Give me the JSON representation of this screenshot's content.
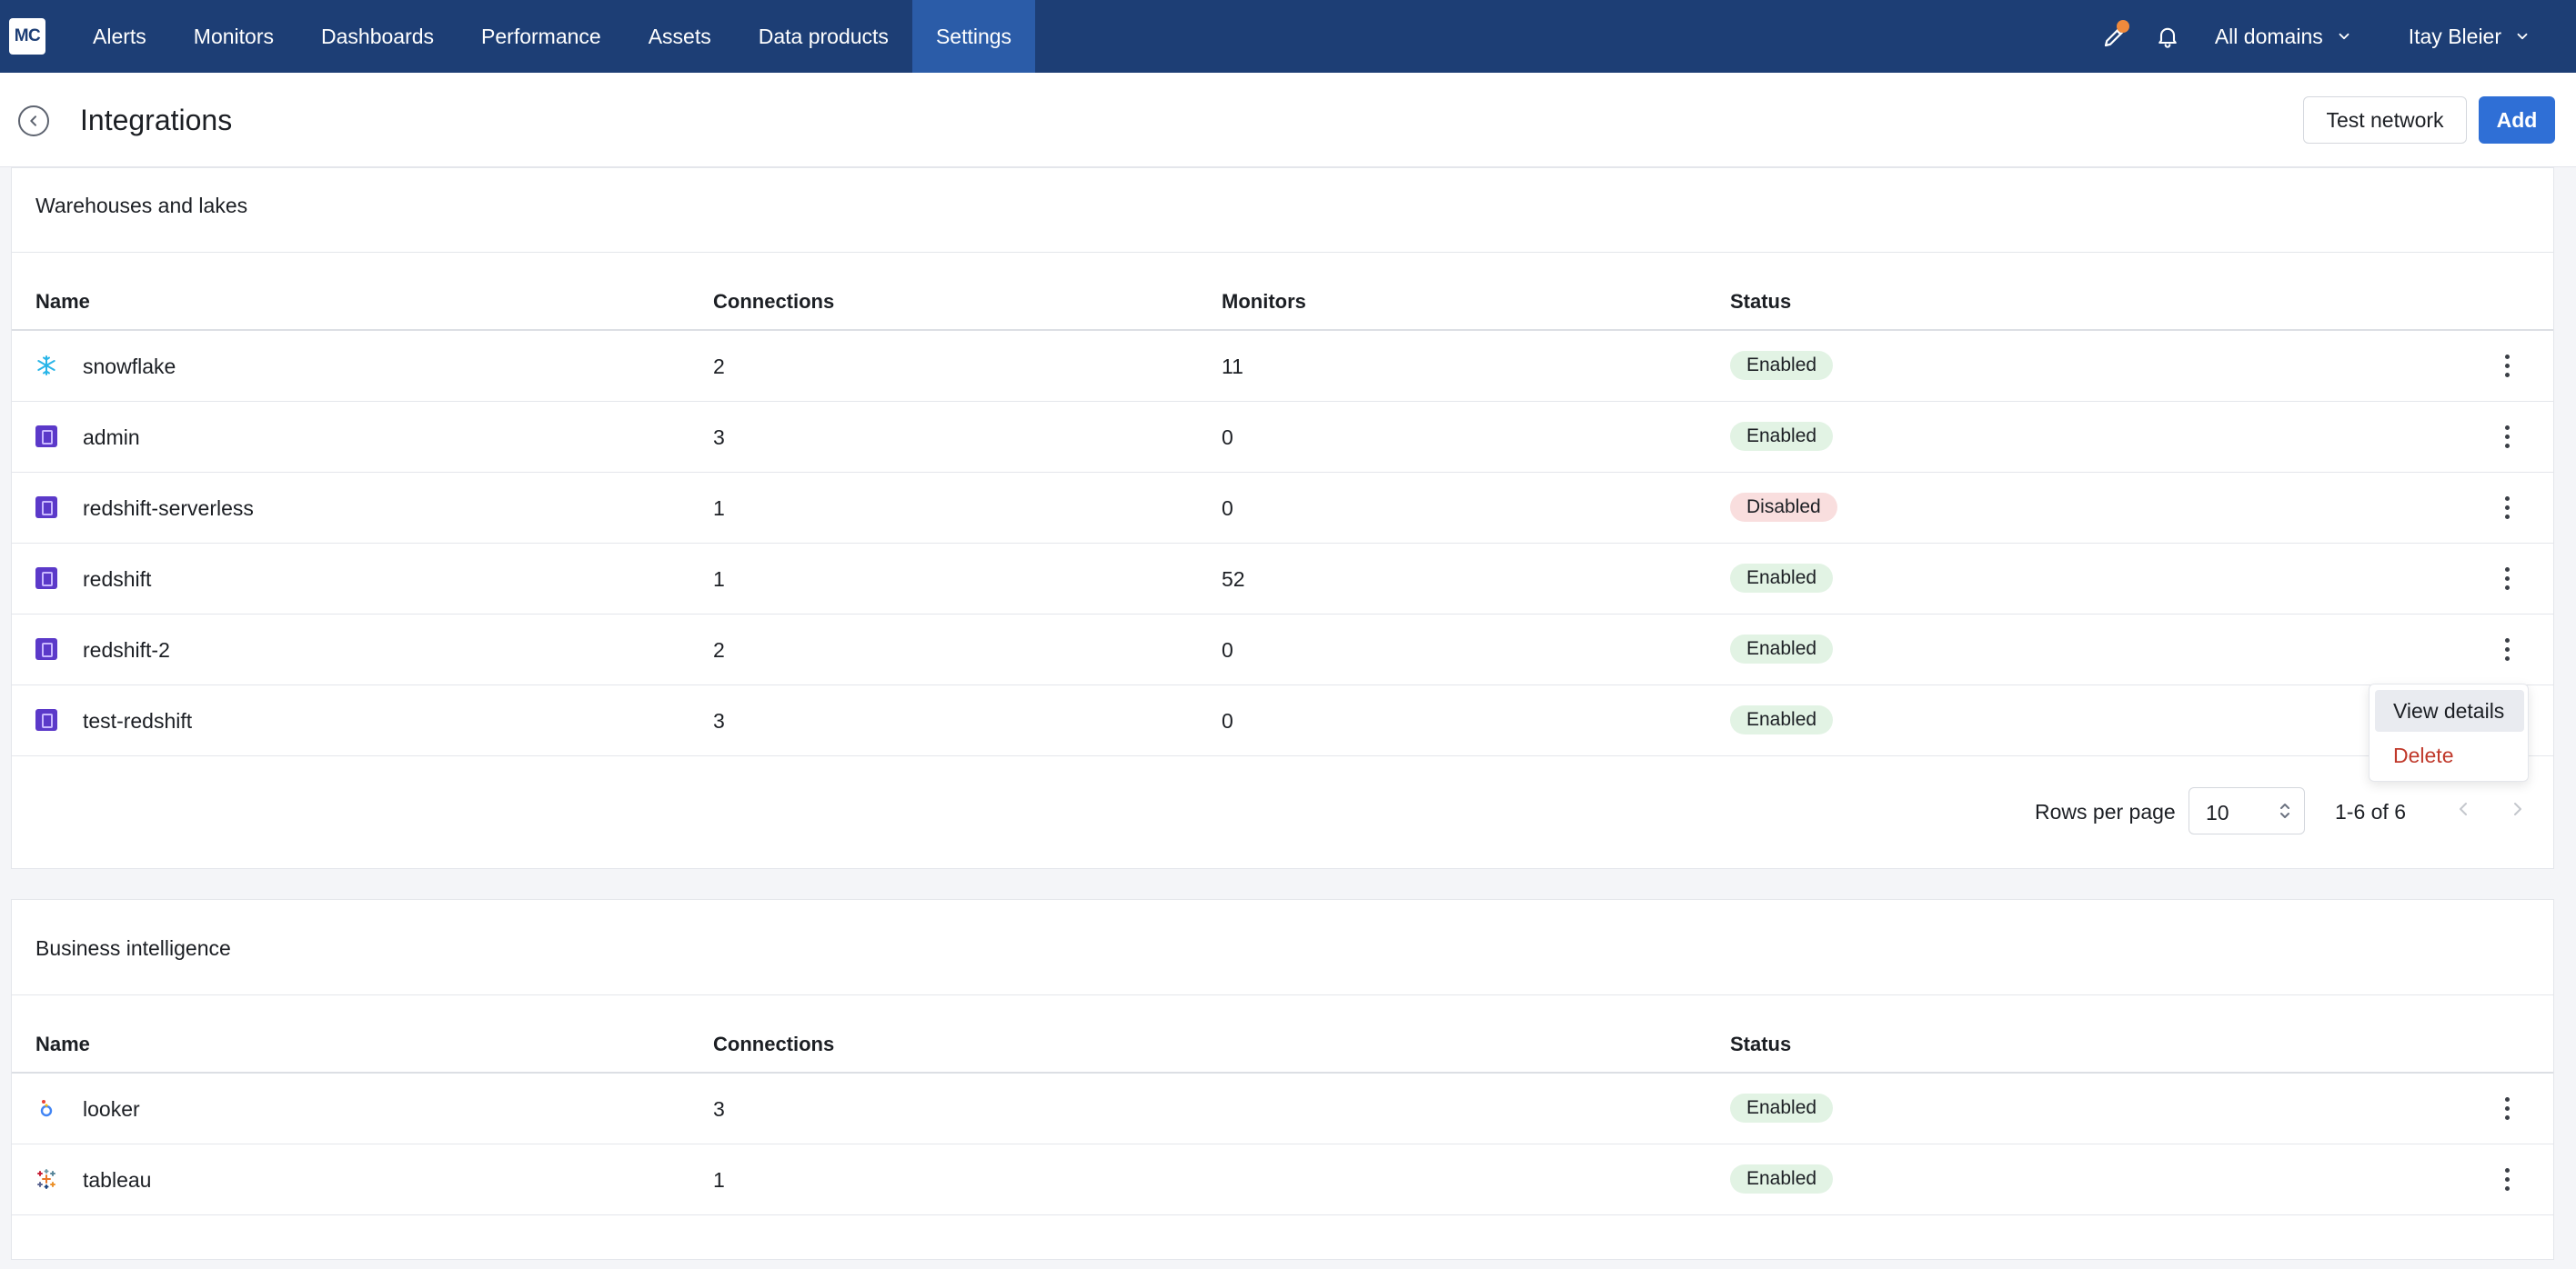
{
  "nav": {
    "logo": "MC",
    "items": [
      "Alerts",
      "Monitors",
      "Dashboards",
      "Performance",
      "Assets",
      "Data products",
      "Settings"
    ],
    "active": "Settings",
    "domain_label": "All domains",
    "user_label": "Itay Bleier",
    "icons": [
      "pencil-sparkle-icon",
      "bell-icon"
    ]
  },
  "header": {
    "title": "Integrations",
    "test_network_label": "Test network",
    "add_label": "Add"
  },
  "warehouses": {
    "title": "Warehouses and lakes",
    "columns": {
      "name": "Name",
      "connections": "Connections",
      "monitors": "Monitors",
      "status": "Status"
    },
    "rows": [
      {
        "icon": "snowflake-icon",
        "name": "snowflake",
        "connections": "2",
        "monitors": "11",
        "status": "Enabled"
      },
      {
        "icon": "redshift-icon",
        "name": "admin",
        "connections": "3",
        "monitors": "0",
        "status": "Enabled"
      },
      {
        "icon": "redshift-icon",
        "name": "redshift-serverless",
        "connections": "1",
        "monitors": "0",
        "status": "Disabled"
      },
      {
        "icon": "redshift-icon",
        "name": "redshift",
        "connections": "1",
        "monitors": "52",
        "status": "Enabled"
      },
      {
        "icon": "redshift-icon",
        "name": "redshift-2",
        "connections": "2",
        "monitors": "0",
        "status": "Enabled"
      },
      {
        "icon": "redshift-icon",
        "name": "test-redshift",
        "connections": "3",
        "monitors": "0",
        "status": "Enabled"
      }
    ],
    "pagination": {
      "rows_per_page_label": "Rows per page",
      "rows_per_page": "10",
      "range": "1-6 of 6"
    }
  },
  "row_menu": {
    "view_details": "View details",
    "delete": "Delete"
  },
  "bi": {
    "title": "Business intelligence",
    "columns": {
      "name": "Name",
      "connections": "Connections",
      "status": "Status"
    },
    "rows": [
      {
        "icon": "looker-icon",
        "name": "looker",
        "connections": "3",
        "status": "Enabled"
      },
      {
        "icon": "tableau-icon",
        "name": "tableau",
        "connections": "1",
        "status": "Enabled"
      }
    ]
  },
  "colors": {
    "nav_bg": "#1d3e75",
    "nav_active": "#2b5ca8",
    "primary": "#2f6fd6",
    "enabled_bg": "#e2f3e4",
    "disabled_bg": "#f9dede",
    "danger": "#c0392b"
  }
}
